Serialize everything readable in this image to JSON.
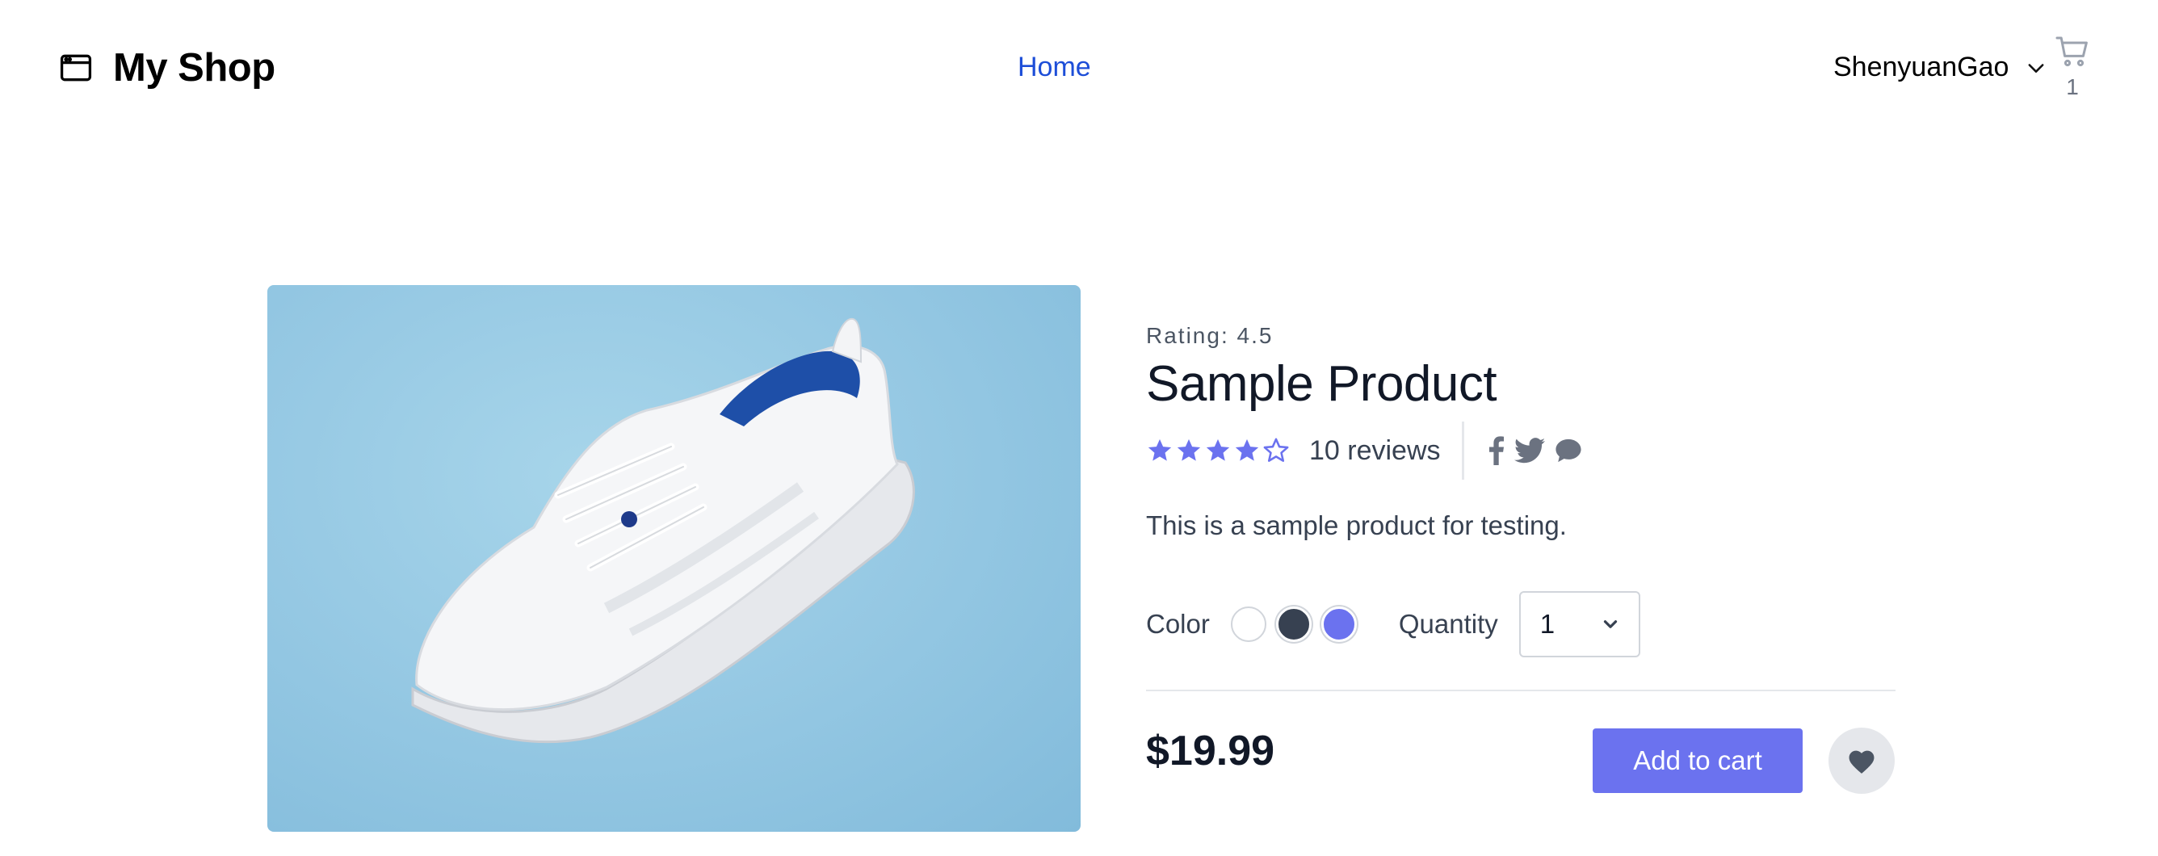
{
  "header": {
    "brand_name": "My Shop",
    "brand_icon": "browser-window-icon",
    "nav_home": "Home",
    "user_name": "ShenyuanGao",
    "cart_count": "1"
  },
  "product": {
    "rating_text": "Rating: 4.5",
    "title": "Sample Product",
    "stars_filled": 4,
    "stars_total": 5,
    "reviews": "10 reviews",
    "description": "This is a sample product for testing.",
    "color_label": "Color",
    "colors": [
      "#ffffff",
      "#374151",
      "#6b72ef"
    ],
    "quantity_label": "Quantity",
    "quantity_value": "1",
    "price": "$19.99",
    "add_to_cart": "Add to cart",
    "image_subject": "white sneaker on blue background"
  },
  "colors": {
    "accent": "#6b72ef",
    "link": "#1d4ed8",
    "star": "#6b72ef",
    "muted": "#6b7280"
  }
}
